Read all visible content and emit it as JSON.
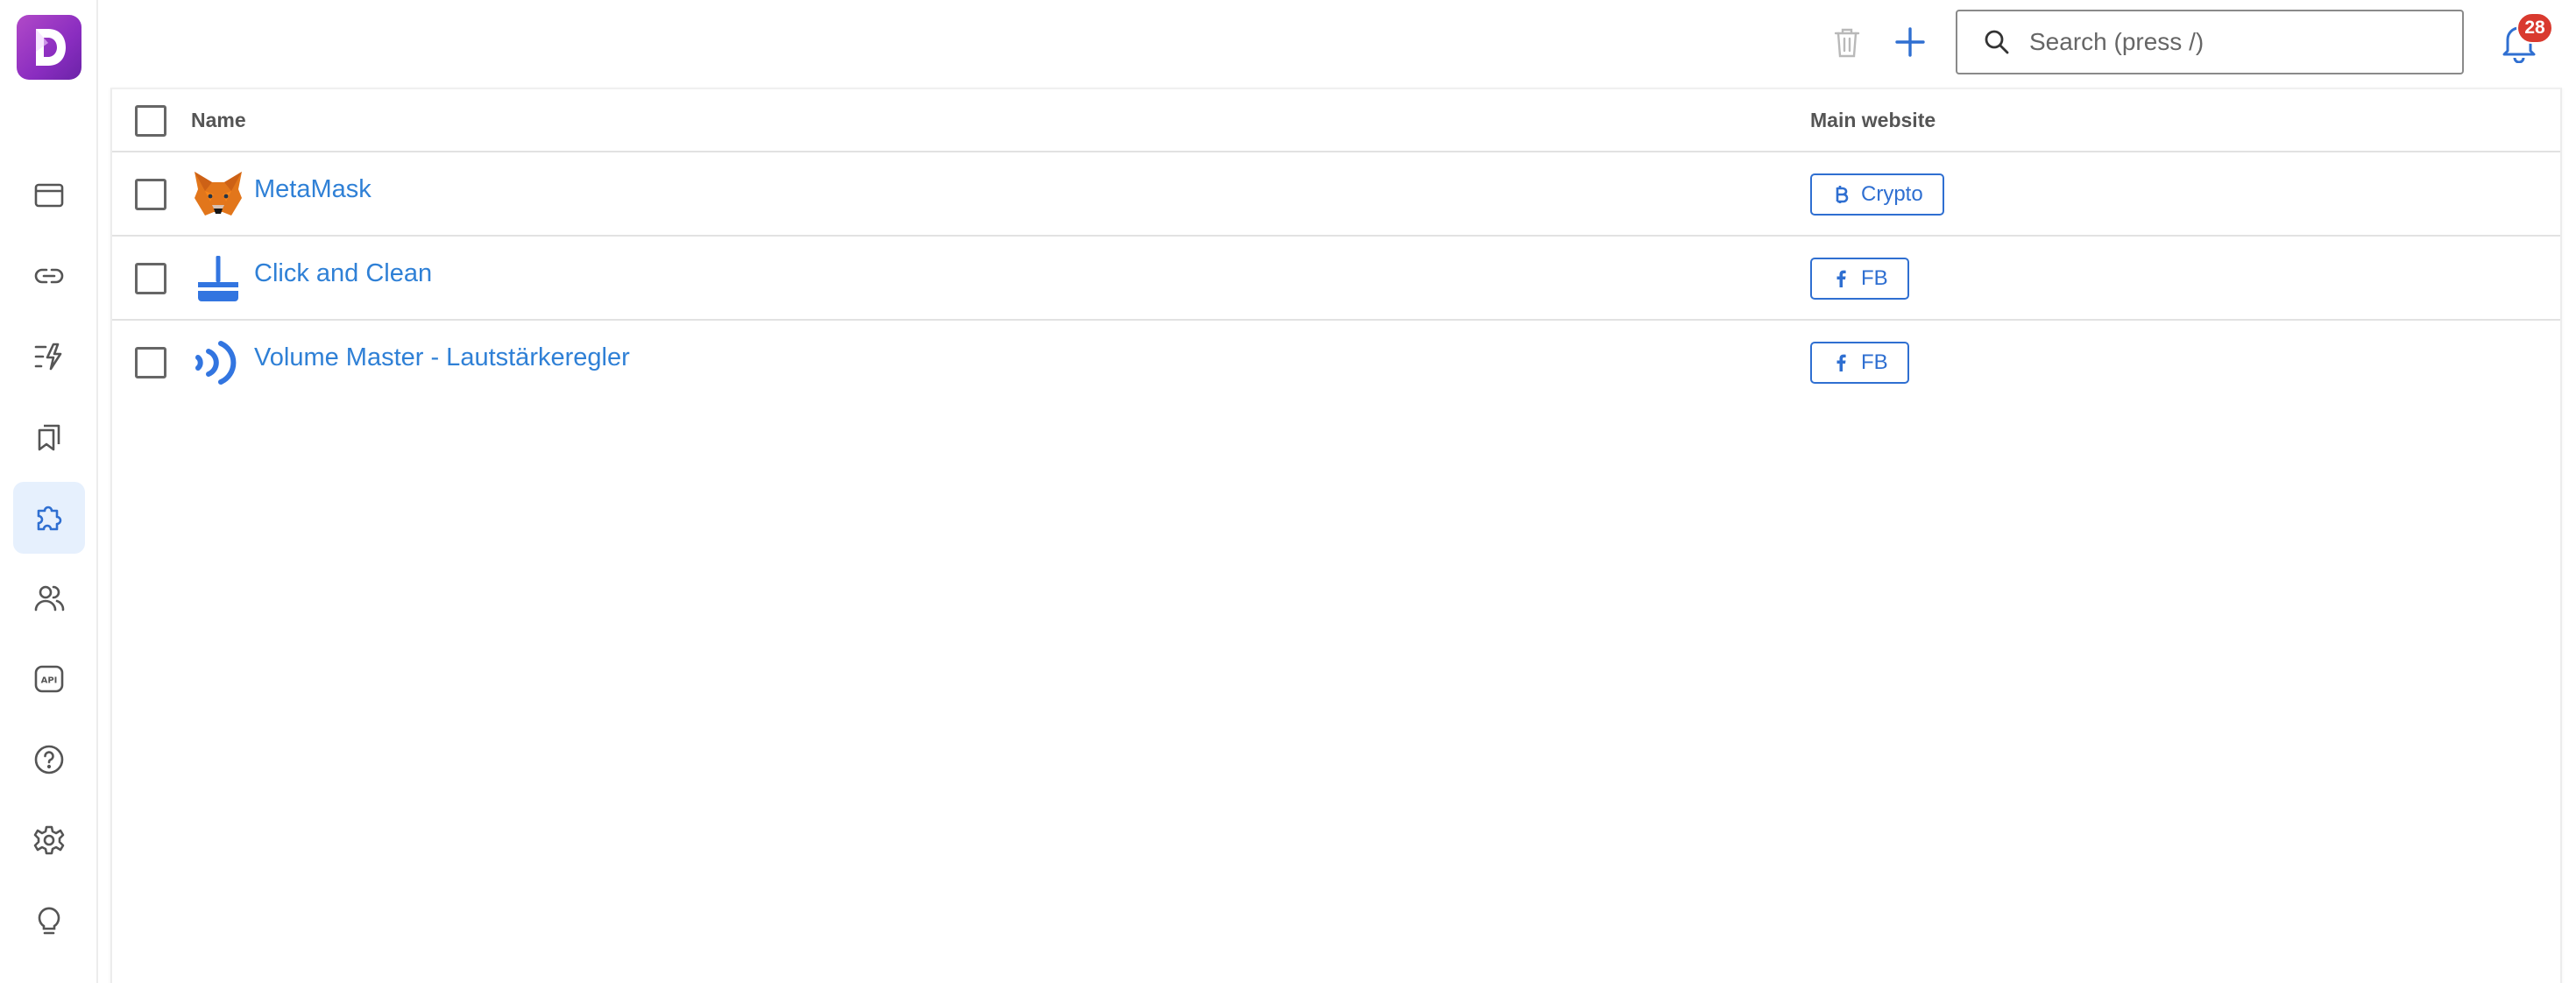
{
  "app": {
    "logo_letter": "D",
    "brand_color": "#9b3cc7",
    "accent_color": "#2f6fd1"
  },
  "sidebar": {
    "items": [
      {
        "name": "browser-profiles",
        "icon": "window-icon",
        "active": false
      },
      {
        "name": "proxies",
        "icon": "link-icon",
        "active": false
      },
      {
        "name": "automation",
        "icon": "lightning-list-icon",
        "active": false
      },
      {
        "name": "bookmarks",
        "icon": "bookmarks-icon",
        "active": false
      },
      {
        "name": "extensions",
        "icon": "puzzle-icon",
        "active": true
      },
      {
        "name": "team",
        "icon": "users-icon",
        "active": false
      },
      {
        "name": "api",
        "icon": "api-icon",
        "active": false
      },
      {
        "name": "help",
        "icon": "question-icon",
        "active": false
      },
      {
        "name": "settings",
        "icon": "gear-icon",
        "active": false
      },
      {
        "name": "tips",
        "icon": "lightbulb-icon",
        "active": false
      }
    ]
  },
  "toolbar": {
    "search_placeholder": "Search (press /)",
    "notifications_count": "28"
  },
  "table": {
    "columns": {
      "name": "Name",
      "main_website": "Main website"
    },
    "rows": [
      {
        "name": "MetaMask",
        "icon": "metamask-fox-icon",
        "website": "Crypto",
        "website_icon": "bitcoin-icon"
      },
      {
        "name": "Click and Clean",
        "icon": "broom-icon",
        "website": "FB",
        "website_icon": "facebook-icon"
      },
      {
        "name": "Volume Master - Lautstärkeregler",
        "icon": "sound-waves-icon",
        "website": "FB",
        "website_icon": "facebook-icon"
      }
    ]
  }
}
